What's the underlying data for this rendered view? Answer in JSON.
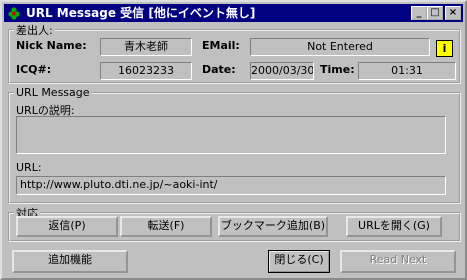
{
  "window": {
    "title": "URL Message 受信 [他にイベント無し]",
    "min_glyph": "_",
    "max_glyph": "□",
    "close_glyph": "×"
  },
  "sender": {
    "legend": "差出人:",
    "nick_label": "Nick Name:",
    "nick_value": "青木老師",
    "email_label": "EMail:",
    "email_value": "Not Entered",
    "icq_label": "ICQ#:",
    "icq_value": "16023233",
    "date_label": "Date:",
    "date_value": "2000/03/30",
    "time_label": "Time:",
    "time_value": "01:31",
    "info_glyph": "i"
  },
  "url_message": {
    "legend": "URL Message",
    "desc_label": "URLの説明:",
    "desc_value": "",
    "url_label": "URL:",
    "url_value": "http://www.pluto.dti.ne.jp/~aoki-int/"
  },
  "actions": {
    "legend": "対応",
    "reply": "返信(P)",
    "forward": "転送(F)",
    "bookmark": "ブックマーク追加(B)",
    "open_url": "URLを開く(G)"
  },
  "footer": {
    "extra": "追加機能",
    "close": "閉じる(C)",
    "read_next": "Read Next"
  },
  "colors": {
    "titlebar": "#000080",
    "face": "#c0c0c0"
  }
}
